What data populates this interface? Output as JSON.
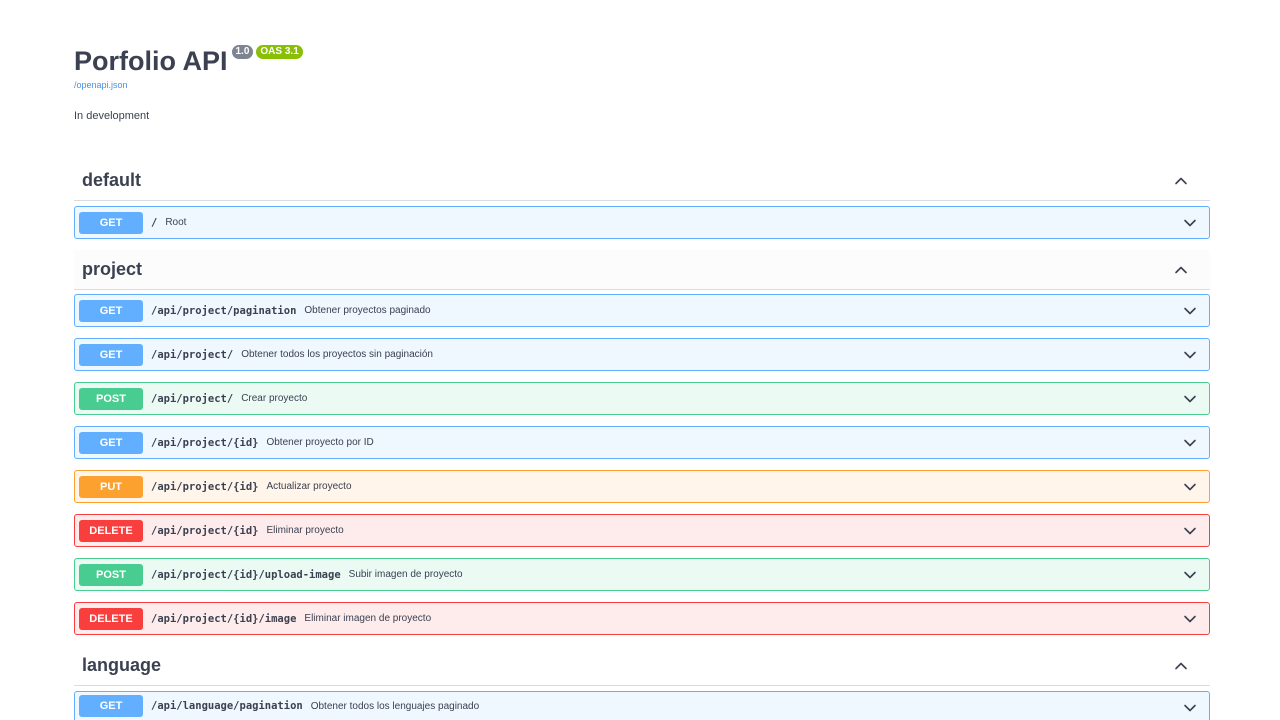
{
  "info": {
    "title": "Porfolio API",
    "version_badge": "1.0",
    "oas_badge": "OAS 3.1",
    "spec_link": "/openapi.json",
    "description": "In development"
  },
  "tags": [
    {
      "name": "default",
      "operations": [
        {
          "method": "GET",
          "path": "/",
          "summary": "Root"
        }
      ]
    },
    {
      "name": "project",
      "operations": [
        {
          "method": "GET",
          "path": "/api/project/pagination",
          "summary": "Obtener proyectos paginado"
        },
        {
          "method": "GET",
          "path": "/api/project/",
          "summary": "Obtener todos los proyectos sin paginación"
        },
        {
          "method": "POST",
          "path": "/api/project/",
          "summary": "Crear proyecto"
        },
        {
          "method": "GET",
          "path": "/api/project/{id}",
          "summary": "Obtener proyecto por ID"
        },
        {
          "method": "PUT",
          "path": "/api/project/{id}",
          "summary": "Actualizar proyecto"
        },
        {
          "method": "DELETE",
          "path": "/api/project/{id}",
          "summary": "Eliminar proyecto"
        },
        {
          "method": "POST",
          "path": "/api/project/{id}/upload-image",
          "summary": "Subir imagen de proyecto"
        },
        {
          "method": "DELETE",
          "path": "/api/project/{id}/image",
          "summary": "Eliminar imagen de proyecto"
        }
      ]
    },
    {
      "name": "language",
      "operations": [
        {
          "method": "GET",
          "path": "/api/language/pagination",
          "summary": "Obtener todos los lenguajes paginado"
        }
      ]
    }
  ],
  "colors": {
    "get": "#61affe",
    "post": "#49cc90",
    "put": "#fca130",
    "delete": "#f93e3e",
    "badge_version": "#7d8492",
    "badge_oas": "#89bf04",
    "link": "#4990e2"
  },
  "icons": {
    "tag_toggle": "chevron-up-icon",
    "operation_toggle": "chevron-down-icon"
  }
}
